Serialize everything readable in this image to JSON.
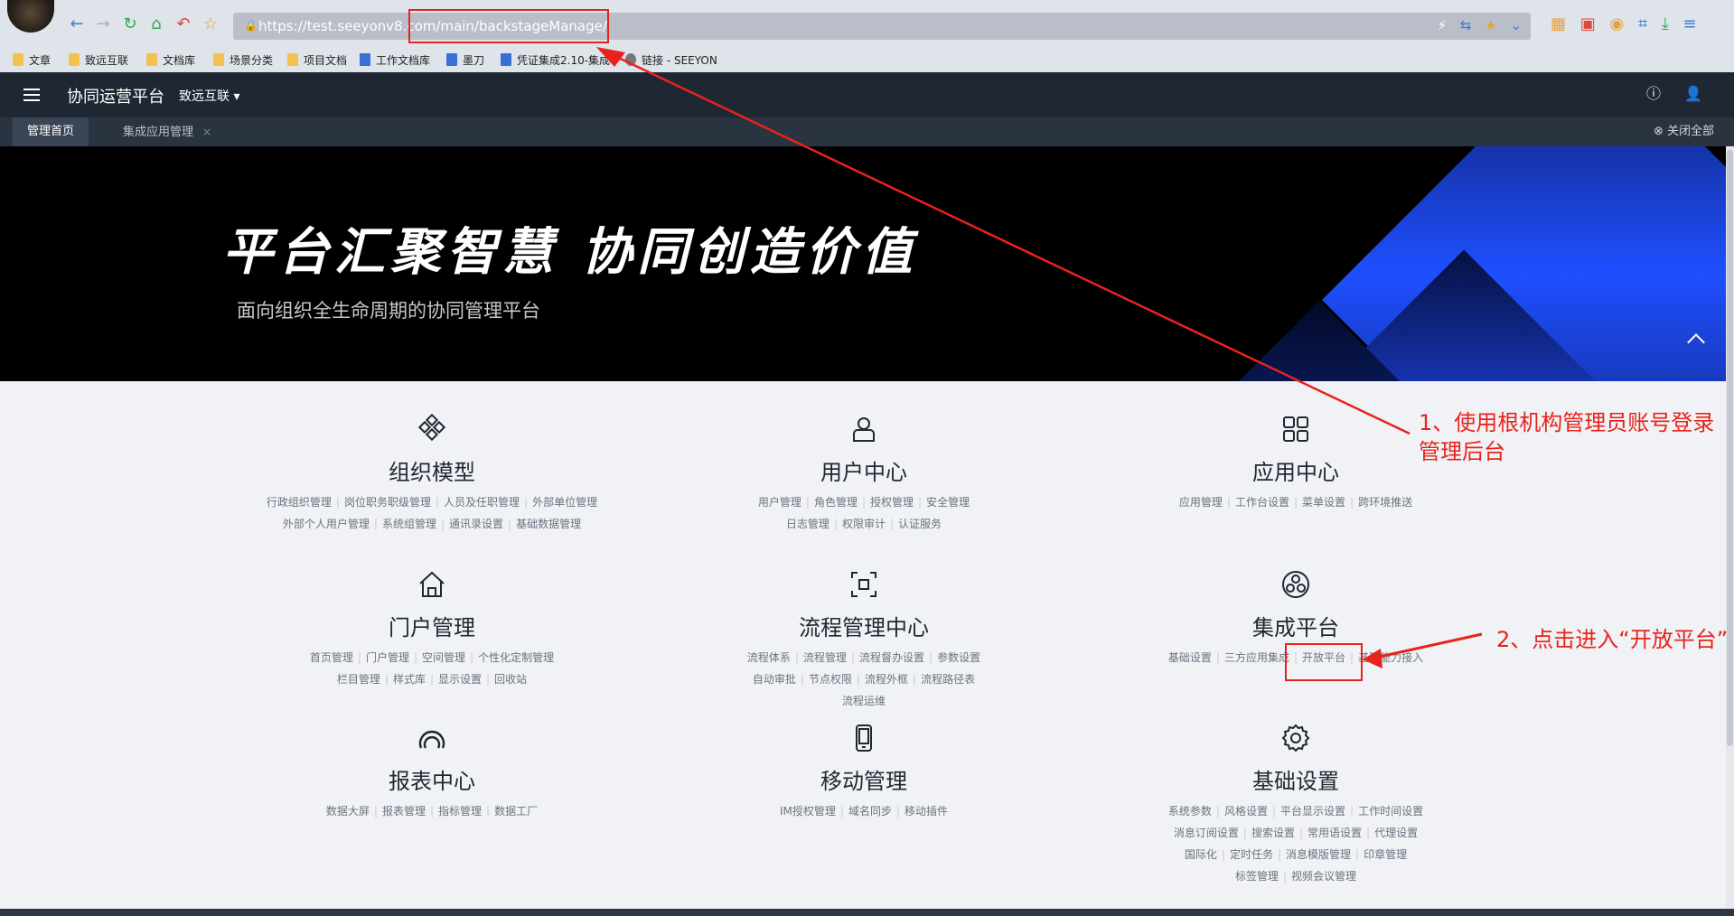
{
  "browser": {
    "url": "https://test.seeyonv8.com/main/backstageManage/",
    "bookmarks": [
      "文章",
      "致远互联",
      "文档库",
      "场景分类",
      "项目文档",
      "工作文档库",
      "墨刀",
      "凭证集成2.10-集成",
      "链接 - SEEYON"
    ]
  },
  "header": {
    "app_title": "协同运营平台",
    "org_select": "致远互联"
  },
  "tabs": [
    {
      "label": "管理首页"
    },
    {
      "label": "集成应用管理"
    }
  ],
  "close_all": "关闭全部",
  "banner": {
    "title": "平台汇聚智慧 协同创造价值",
    "subtitle": "面向组织全生命周期的协同管理平台"
  },
  "modules": [
    {
      "title": "组织模型",
      "icon": "org-model-icon",
      "links": [
        "行政组织管理",
        "岗位职务职级管理",
        "人员及任职管理",
        "外部单位管理",
        "外部个人用户管理",
        "系统组管理",
        "通讯录设置",
        "基础数据管理"
      ]
    },
    {
      "title": "用户中心",
      "icon": "user-center-icon",
      "links": [
        "用户管理",
        "角色管理",
        "授权管理",
        "安全管理",
        "日志管理",
        "权限审计",
        "认证服务"
      ]
    },
    {
      "title": "应用中心",
      "icon": "app-center-icon",
      "links": [
        "应用管理",
        "工作台设置",
        "菜单设置",
        "跨环境推送"
      ]
    },
    {
      "title": "门户管理",
      "icon": "portal-icon",
      "links": [
        "首页管理",
        "门户管理",
        "空间管理",
        "个性化定制管理",
        "栏目管理",
        "样式库",
        "显示设置",
        "回收站"
      ]
    },
    {
      "title": "流程管理中心",
      "icon": "process-icon",
      "links": [
        "流程体系",
        "流程管理",
        "流程督办设置",
        "参数设置",
        "自动审批",
        "节点权限",
        "流程外框",
        "流程路径表",
        "流程运维"
      ]
    },
    {
      "title": "集成平台",
      "icon": "integration-icon",
      "links": [
        "基础设置",
        "三方应用集成",
        "开放平台",
        "基础能力接入"
      ]
    },
    {
      "title": "报表中心",
      "icon": "report-icon",
      "links": [
        "数据大屏",
        "报表管理",
        "指标管理",
        "数据工厂"
      ]
    },
    {
      "title": "移动管理",
      "icon": "mobile-icon",
      "links": [
        "IM授权管理",
        "域名同步",
        "移动插件"
      ]
    },
    {
      "title": "基础设置",
      "icon": "settings-icon",
      "links": [
        "系统参数",
        "风格设置",
        "平台显示设置",
        "工作时间设置",
        "消息订阅设置",
        "搜索设置",
        "常用语设置",
        "代理设置",
        "国际化",
        "定时任务",
        "消息模版管理",
        "印章管理",
        "标签管理",
        "视频会议管理"
      ]
    }
  ],
  "annotations": {
    "step1": "1、使用根机构管理员账号登录管理后台",
    "step2": "2、点击进入“开放平台”",
    "color": "#e8231c"
  }
}
